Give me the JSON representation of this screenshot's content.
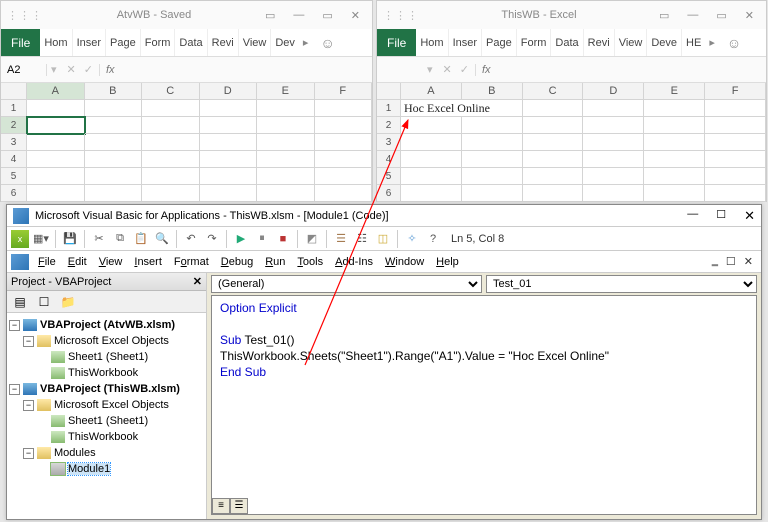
{
  "excel_left": {
    "title": "AtvWB  -  Saved",
    "win_controls": {
      "min": "—",
      "max": "▭",
      "close": "✕"
    },
    "file_tab": "File",
    "ribbon_tabs": [
      "Hom",
      "Inser",
      "Page",
      "Form",
      "Data",
      "Revi",
      "View",
      "Dev"
    ],
    "nav_more": "▸",
    "smiley": "☺",
    "name_box": "A2",
    "fx_x": "✕",
    "fx_check": "✓",
    "fx": "fx",
    "cols": [
      "A",
      "B",
      "C",
      "D",
      "E",
      "F"
    ],
    "rows": [
      "1",
      "2",
      "3",
      "4",
      "5",
      "6"
    ],
    "selected_col": "A",
    "selected_row": "2"
  },
  "excel_right": {
    "title": "ThisWB  -  Excel",
    "win_controls": {
      "min": "—",
      "max": "▭",
      "close": "✕"
    },
    "file_tab": "File",
    "ribbon_tabs": [
      "Hom",
      "Inser",
      "Page",
      "Form",
      "Data",
      "Revi",
      "View",
      "Deve",
      "HE"
    ],
    "nav_more": "▸",
    "smiley": "☺",
    "name_box": "",
    "fx_x": "✕",
    "fx_check": "✓",
    "fx": "fx",
    "cols": [
      "A",
      "B",
      "C",
      "D",
      "E",
      "F"
    ],
    "rows": [
      "1",
      "2",
      "3",
      "4",
      "5",
      "6"
    ],
    "cell_a1": "Hoc Excel Online"
  },
  "vbe": {
    "title": "Microsoft Visual Basic for Applications - ThisWB.xlsm - [Module1 (Code)]",
    "win_controls": {
      "min": "—",
      "max": "☐",
      "close": "✕"
    },
    "cursor_pos": "Ln 5, Col 8",
    "menus": [
      "File",
      "Edit",
      "View",
      "Insert",
      "Format",
      "Debug",
      "Run",
      "Tools",
      "Add-Ins",
      "Window",
      "Help"
    ],
    "mini_controls": {
      "restore": "‗",
      "max": "☐",
      "close": "✕"
    },
    "project_panel": {
      "title": "Project - VBAProject",
      "close": "✕",
      "tree": {
        "proj1": "VBAProject (AtvWB.xlsm)",
        "meo1": "Microsoft Excel Objects",
        "sheet1_1": "Sheet1 (Sheet1)",
        "twb1": "ThisWorkbook",
        "proj2": "VBAProject (ThisWB.xlsm)",
        "meo2": "Microsoft Excel Objects",
        "sheet1_2": "Sheet1 (Sheet1)",
        "twb2": "ThisWorkbook",
        "modules": "Modules",
        "module1": "Module1"
      }
    },
    "combo_left": "(General)",
    "combo_right": "Test_01",
    "code": {
      "l1_kw": "Option Explicit",
      "l2_kw": "Sub ",
      "l2_txt": "Test_01()",
      "l3_txt": "ThisWorkbook.Sheets(\"Sheet1\").Range(\"A1\").Value = \"Hoc Excel Online\"",
      "l4_kw": "End Sub"
    }
  }
}
